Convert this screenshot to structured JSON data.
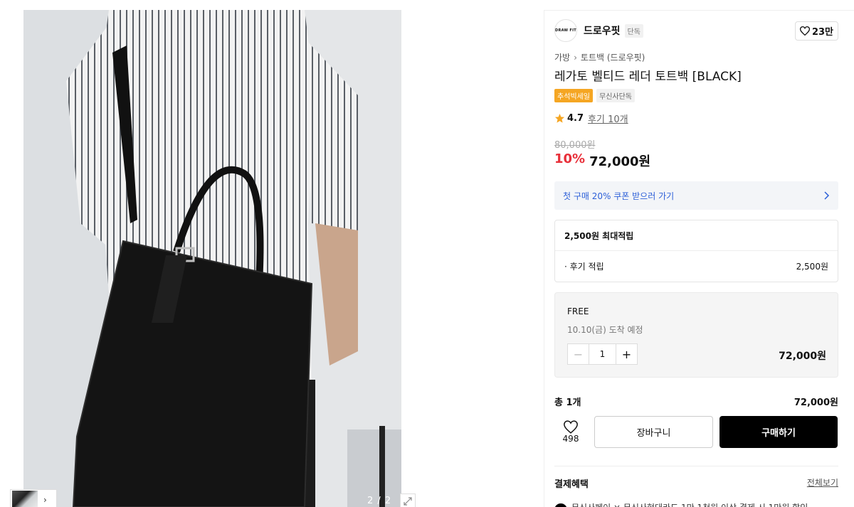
{
  "gallery": {
    "counter": "2 / 2"
  },
  "brand": {
    "logo_text": "DRAW FIT",
    "name": "드로우핏",
    "badge": "단독",
    "like_count": "23만"
  },
  "breadcrumb": {
    "category": "가방",
    "sub_category": "토트백 (드로우핏)"
  },
  "product": {
    "title": "레가토 벨티드 레더 토트백 [BLACK]",
    "tags": [
      "추석빅세일",
      "무신사단독"
    ],
    "rating": "4.7",
    "reviews": "후기 10개",
    "original_price": "80,000원",
    "discount": "10%",
    "price": "72,000원"
  },
  "coupon": {
    "text": "첫 구매 20% 쿠폰 받으러 가기"
  },
  "points": {
    "header": "2,500원 최대적립",
    "row_label": "· 후기 적립",
    "row_value": "2,500원"
  },
  "option": {
    "name": "FREE",
    "arrival": "10.10(금) 도착 예정",
    "quantity": "1",
    "minus": "−",
    "plus": "+",
    "price": "72,000원"
  },
  "total": {
    "label": "총 1개",
    "value": "72,000원"
  },
  "actions": {
    "wish_count": "498",
    "cart_label": "장바구니",
    "buy_label": "구매하기"
  },
  "benefits": {
    "title": "결제혜택",
    "see_all": "전체보기",
    "item1": "무신사페이 × 무신사현대카드 1만 1천원 이상 결제 시 1만원 할인"
  },
  "colors": {
    "accent_red": "#e8303a",
    "coupon_blue": "#2c5fd8",
    "sale_tag": "#f5a623",
    "buy_button": "#000000"
  }
}
